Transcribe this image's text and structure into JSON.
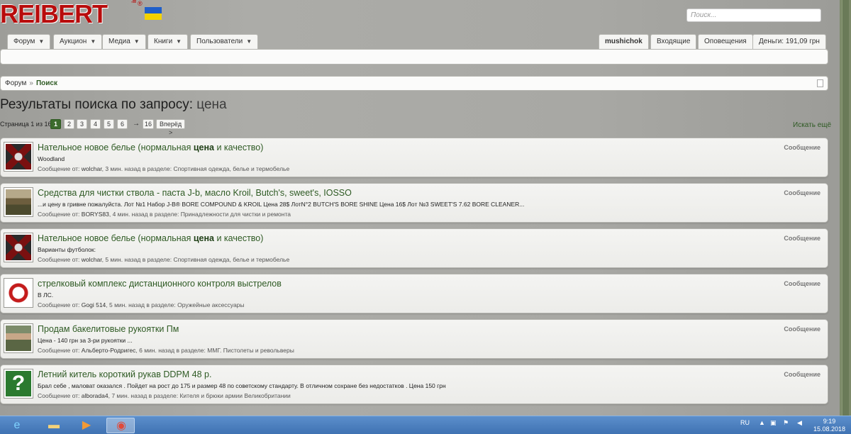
{
  "logo": {
    "text": "REIBERT",
    "info": "info",
    "reg": "®"
  },
  "search": {
    "placeholder": "Поиск..."
  },
  "nav": {
    "tabs": [
      "Форум",
      "Аукцион",
      "Медиа",
      "Книги",
      "Пользователи"
    ],
    "user": "mushichok",
    "inbox": "Входящие",
    "alerts": "Оповещения",
    "money": "Деньги: 191,09 грн"
  },
  "breadcrumb": {
    "forum": "Форум",
    "sep": "»",
    "current": "Поиск"
  },
  "title": {
    "prefix": "Результаты поиска по запросу:",
    "query": "цена"
  },
  "pager": {
    "label": "Страница 1 из 16",
    "pages": [
      "1",
      "2",
      "3",
      "4",
      "5",
      "6"
    ],
    "arrow": "→",
    "last": "16",
    "next": "Вперёд >",
    "more": "Искать ещё"
  },
  "results": [
    {
      "t1": "Нательное новое белье (нормальная ",
      "tb": "цена",
      "t2": " и качество)",
      "snippet": "Woodland",
      "meta_pre": "Сообщение от: ",
      "user": "wolchar",
      "meta_post": ", 3 мин. назад в разделе: Спортивная одежда, белье и термобелье",
      "type": "Сообщение"
    },
    {
      "t1": "Средства для чистки ствола - паста J-b, масло Kroil, Butch's, sweet's, IOSSO",
      "tb": "",
      "t2": "",
      "snippet": "...и цену в гривне пожалуйста. Лот №1 Набор J-B® BORE COMPOUND & KROIL Цена 28$ ЛотN°2 BUTCH'S BORE SHINE Цена 16$ Лот №3 SWEET'S 7.62 BORE CLEANER...",
      "meta_pre": "Сообщение от: ",
      "user": "BORYS83",
      "meta_post": ", 4 мин. назад в разделе: Принадлежности для чистки и ремонта",
      "type": "Сообщение"
    },
    {
      "t1": "Нательное новое белье (нормальная ",
      "tb": "цена",
      "t2": " и качество)",
      "snippet": "Варианты футболок:",
      "meta_pre": "Сообщение от: ",
      "user": "wolchar",
      "meta_post": ", 5 мин. назад в разделе: Спортивная одежда, белье и термобелье",
      "type": "Сообщение"
    },
    {
      "t1": "стрелковый комплекс дистанционного контроля выстрелов",
      "tb": "",
      "t2": "",
      "snippet": "В ЛС.",
      "meta_pre": "Сообщение от: ",
      "user": "Gogi 514",
      "meta_post": ", 5 мин. назад в разделе: Оружейные аксессуары",
      "type": "Сообщение"
    },
    {
      "t1": "Продам бакелитовые рукоятки Пм",
      "tb": "",
      "t2": "",
      "snippet": "Цена - 140 грн за 3-ри рукоятки ...",
      "meta_pre": "Сообщение от: ",
      "user": "Альберто-Родригес",
      "meta_post": ", 6 мин. назад в разделе: ММГ. Пистолеты и револьверы",
      "type": "Сообщение"
    },
    {
      "t1": "Летний китель короткий рукав DDPM 48 р.",
      "tb": "",
      "t2": "",
      "snippet": "Брал себе , маловат оказался . Пойдет на рост до 175 и размер 48 по советскому стандарту. В отличном сохране без недостатков . Цена 150 грн",
      "meta_pre": "Сообщение от: ",
      "user": "alborada4",
      "meta_post": ", 7 мин. назад в разделе: Кителя и брюки армии Великобритании",
      "type": "Сообщение"
    }
  ],
  "taskbar": {
    "lang": "RU",
    "time": "9:19",
    "date": "15.08.2018"
  }
}
